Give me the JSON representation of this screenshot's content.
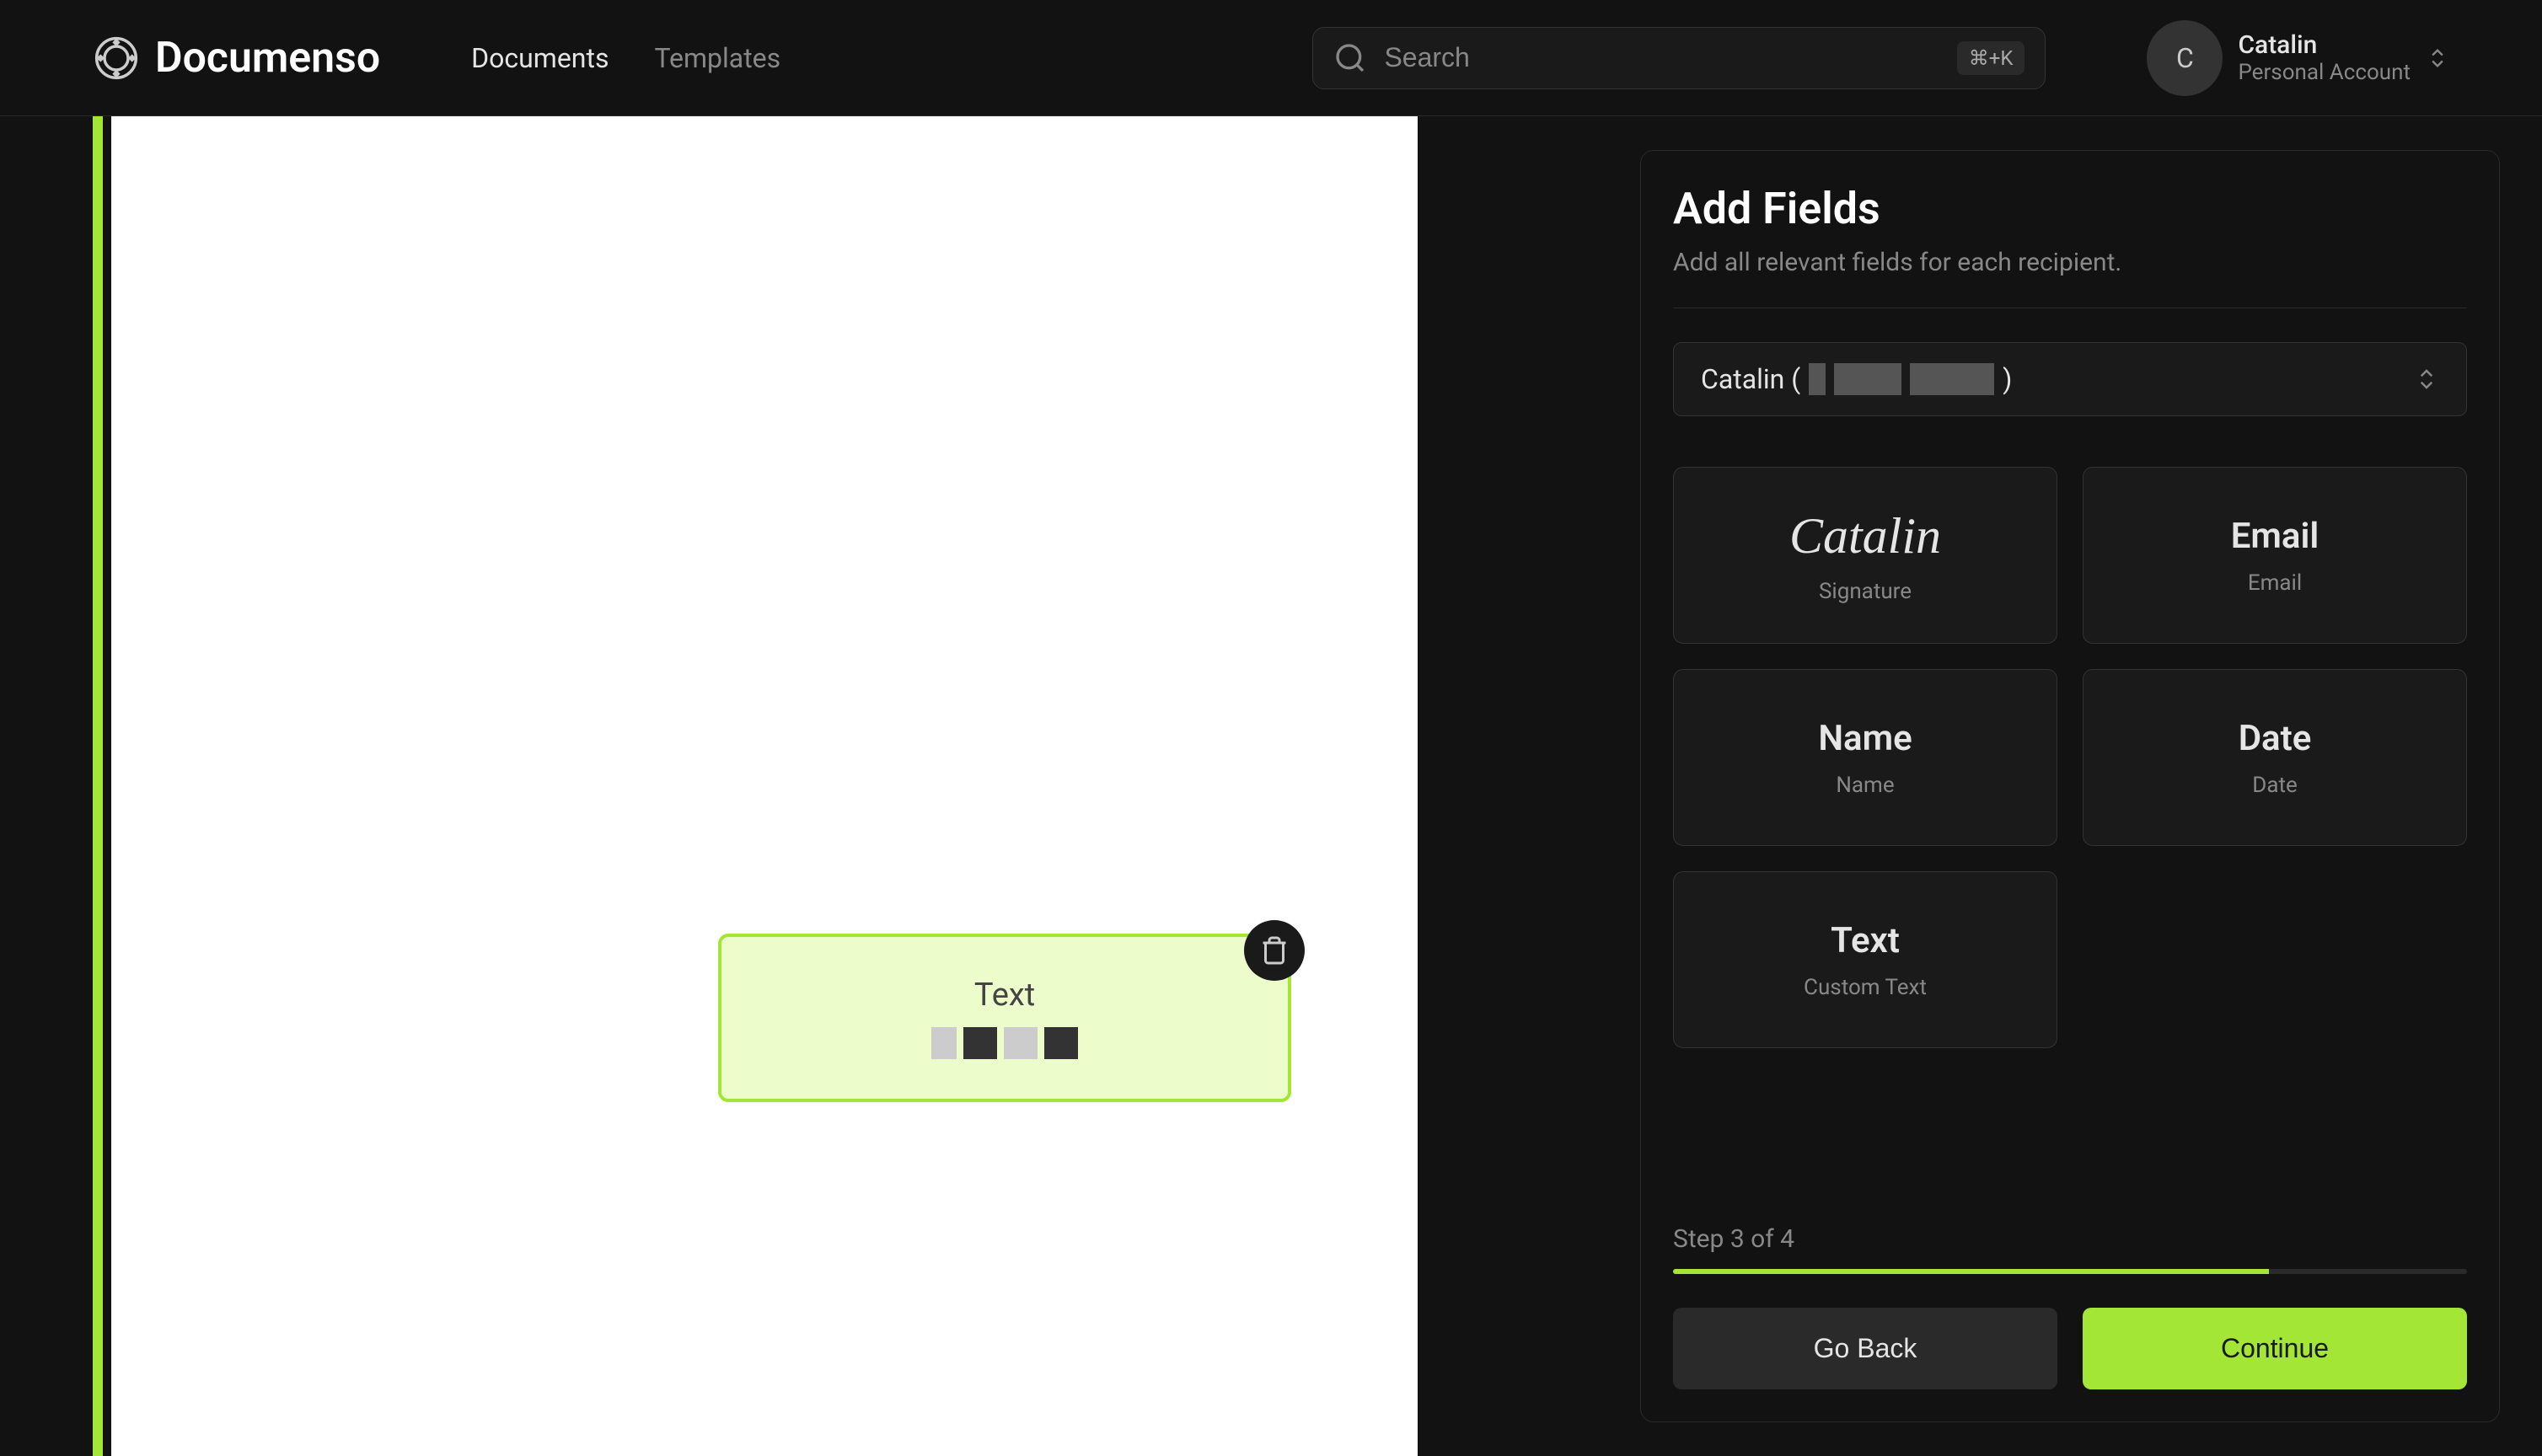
{
  "brand": {
    "name": "Documenso"
  },
  "nav": {
    "documents": "Documents",
    "templates": "Templates"
  },
  "search": {
    "placeholder": "Search",
    "shortcut": "⌘+K"
  },
  "user": {
    "initial": "C",
    "name": "Catalin",
    "account": "Personal Account"
  },
  "sidebar": {
    "title": "Add Fields",
    "subtitle": "Add all relevant fields for each recipient.",
    "recipient": {
      "prefix": "Catalin (",
      "suffix": ")"
    },
    "fields": {
      "signature": {
        "title": "Catalin",
        "subtitle": "Signature"
      },
      "email": {
        "title": "Email",
        "subtitle": "Email"
      },
      "name": {
        "title": "Name",
        "subtitle": "Name"
      },
      "date": {
        "title": "Date",
        "subtitle": "Date"
      },
      "text": {
        "title": "Text",
        "subtitle": "Custom Text"
      }
    },
    "step": "Step 3 of 4",
    "back": "Go Back",
    "continue": "Continue"
  },
  "document": {
    "placedField": {
      "label": "Text"
    }
  }
}
